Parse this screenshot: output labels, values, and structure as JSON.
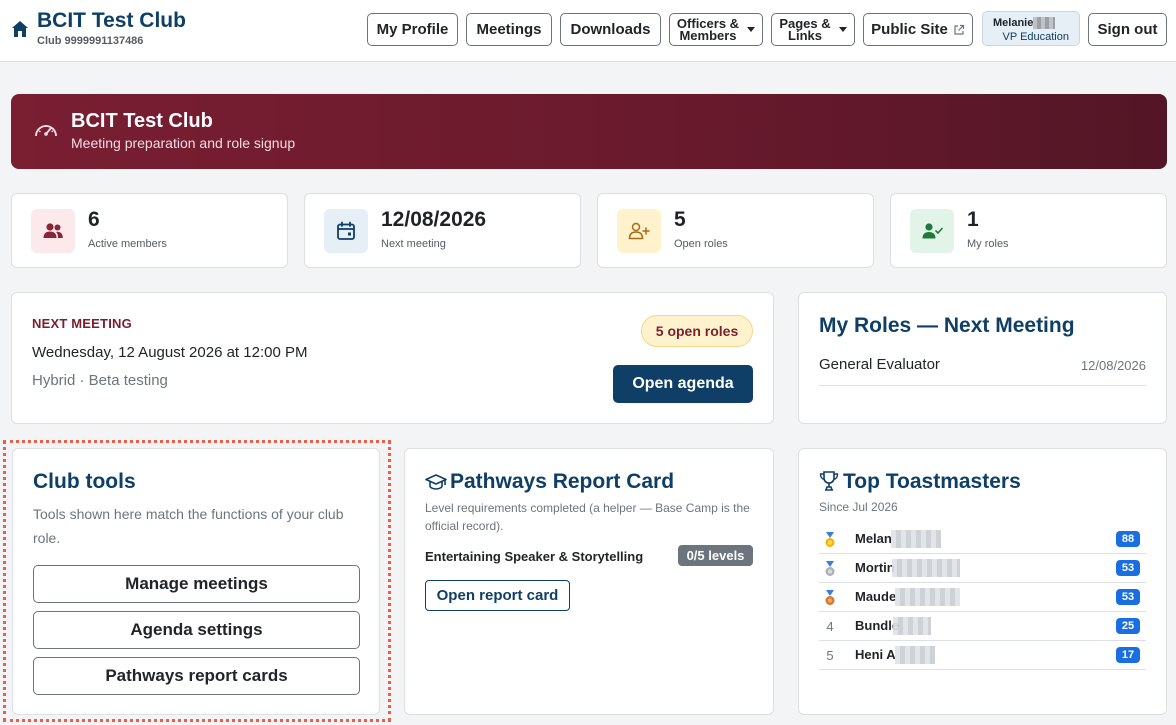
{
  "header": {
    "club_name": "BCIT Test Club",
    "club_number": "Club 9999991137486",
    "nav": {
      "my_profile": "My Profile",
      "meetings": "Meetings",
      "downloads": "Downloads",
      "officers_line1": "Officers &",
      "officers_line2": "Members",
      "pages_line1": "Pages &",
      "pages_line2": "Links",
      "public_site": "Public Site",
      "sign_out": "Sign out"
    },
    "user": {
      "name": "Melanie",
      "role": "VP Education"
    }
  },
  "banner": {
    "title": "BCIT Test Club",
    "subtitle": "Meeting preparation and role signup",
    "gradient_start": "#7a1e32",
    "gradient_end": "#531626"
  },
  "stats": [
    {
      "value": "6",
      "label": "Active members",
      "icon": "users-icon",
      "bg": "#fbe9ec",
      "fg": "#8a2438"
    },
    {
      "value": "12/08/2026",
      "label": "Next meeting",
      "icon": "calendar-icon",
      "bg": "#e6eef6",
      "fg": "#0f3f66"
    },
    {
      "value": "5",
      "label": "Open roles",
      "icon": "user-plus-icon",
      "bg": "#fff3cd",
      "fg": "#a86a12"
    },
    {
      "value": "1",
      "label": "My roles",
      "icon": "user-check-icon",
      "bg": "#e2f3e7",
      "fg": "#1e7a3c"
    }
  ],
  "next_meeting": {
    "label": "NEXT MEETING",
    "datetime": "Wednesday, 12 August 2026 at 12:00 PM",
    "location": "Hybrid · Beta testing",
    "open_roles_badge": "5 open roles",
    "open_agenda_label": "Open agenda"
  },
  "my_roles": {
    "title": "My Roles — Next Meeting",
    "rows": [
      {
        "role": "General Evaluator",
        "date": "12/08/2026"
      }
    ]
  },
  "club_tools": {
    "title": "Club tools",
    "description": "Tools shown here match the functions of your club role.",
    "buttons": [
      "Manage meetings",
      "Agenda settings",
      "Pathways report cards"
    ]
  },
  "pathways": {
    "title": "Pathways Report Card",
    "description": "Level requirements completed (a helper — Base Camp is the official record).",
    "path_name": "Entertaining Speaker & Storytelling",
    "levels": "0/5 levels",
    "button": "Open report card"
  },
  "top_toastmasters": {
    "title": "Top Toastmasters",
    "since": "Since Jul 2026",
    "rows": [
      {
        "rank": "1",
        "name": "Melan",
        "score": "88",
        "medal": "gold"
      },
      {
        "rank": "2",
        "name": "Mortin",
        "score": "53",
        "medal": "silver"
      },
      {
        "rank": "3",
        "name": "Maude",
        "score": "53",
        "medal": "bronze"
      },
      {
        "rank": "4",
        "name": "Bundle",
        "score": "25",
        "medal": ""
      },
      {
        "rank": "5",
        "name": "Heni A",
        "score": "17",
        "medal": ""
      }
    ]
  },
  "colors": {
    "brand_blue": "#0f3f66",
    "brand_maroon": "#7a1e32",
    "score_blue": "#1a6fe0",
    "tools_highlight": "#e8604a"
  }
}
